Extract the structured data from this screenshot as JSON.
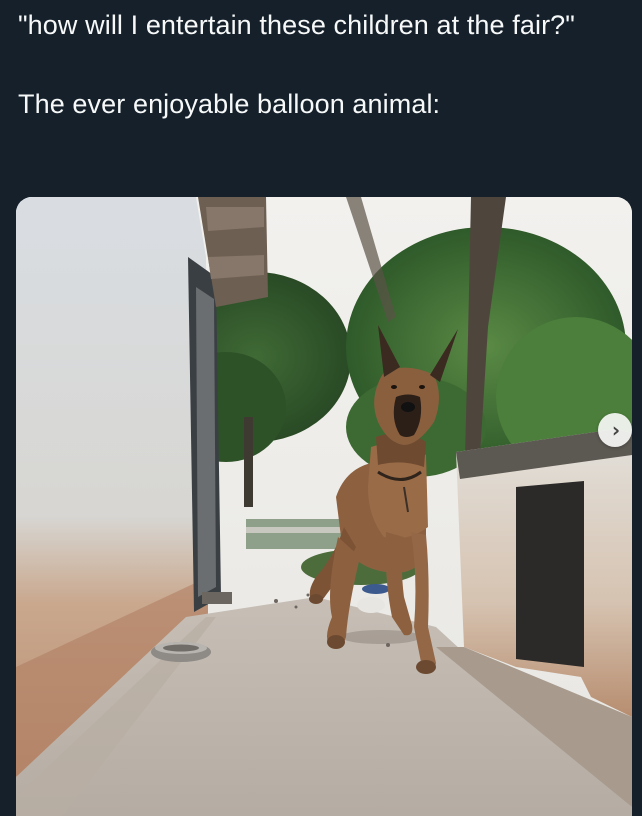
{
  "post": {
    "text_line_1": "\"how will I entertain these children at the fair?\"",
    "text_line_2": "The ever enjoyable balloon animal:"
  },
  "media": {
    "subject": "dog leaping mid-air in a courtyard",
    "next_icon": "chevron-right-icon",
    "next_glyph": "›"
  },
  "colors": {
    "background": "#15202b",
    "text": "#f7f9f9"
  }
}
